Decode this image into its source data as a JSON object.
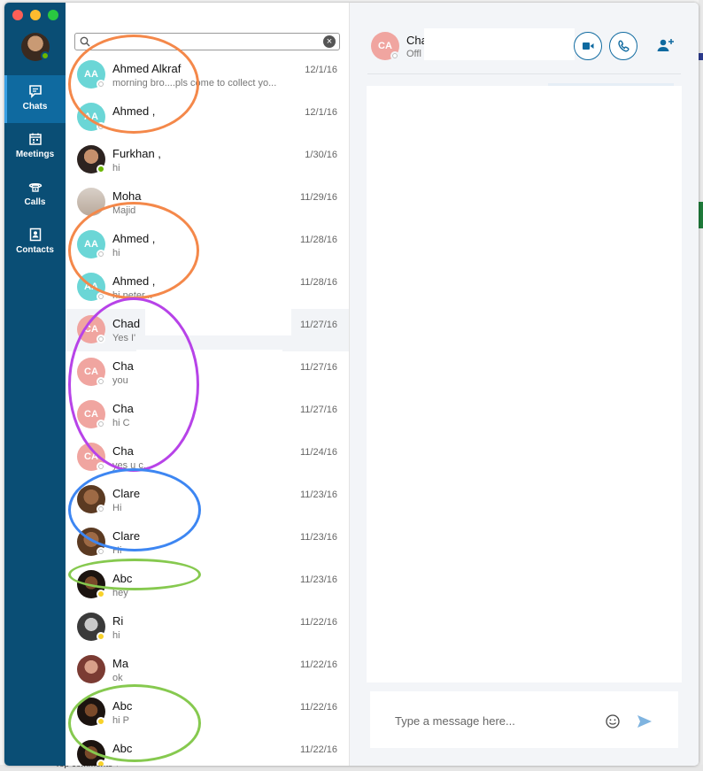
{
  "background": {
    "bottom_text": "Top comments ▾"
  },
  "rail": {
    "nav": [
      {
        "label": "Chats",
        "icon": "chat-icon"
      },
      {
        "label": "Meetings",
        "icon": "calendar-icon"
      },
      {
        "label": "Calls",
        "icon": "phone-icon"
      },
      {
        "label": "Contacts",
        "icon": "contacts-icon"
      }
    ]
  },
  "search": {
    "value": "",
    "placeholder": ""
  },
  "chats": [
    {
      "initials": "AA",
      "name": "Ahmed Alkraf",
      "preview": "morning bro....pls come to collect yo...",
      "date": "12/1/16",
      "presence": "offline"
    },
    {
      "initials": "AA",
      "name": "Ahmed ,",
      "preview": "",
      "date": "12/1/16",
      "presence": "offline"
    },
    {
      "initials": "",
      "name": "Furkhan ,",
      "preview": "hi",
      "date": "1/30/16",
      "presence": "online"
    },
    {
      "initials": "",
      "name": "Moha",
      "preview": "Majid",
      "date": "11/29/16",
      "presence": "none"
    },
    {
      "initials": "AA",
      "name": "Ahmed ,",
      "preview": "hi",
      "date": "11/28/16",
      "presence": "offline"
    },
    {
      "initials": "AA",
      "name": "Ahmed ,",
      "preview": "hi peter...",
      "date": "11/28/16",
      "presence": "offline"
    },
    {
      "initials": "CA",
      "name": "Chad",
      "preview": "Yes I'",
      "date": "11/27/16",
      "presence": "offline"
    },
    {
      "initials": "CA",
      "name": "Cha",
      "preview": "you",
      "date": "11/27/16",
      "presence": "offline"
    },
    {
      "initials": "CA",
      "name": "Cha",
      "preview": "hi C",
      "date": "11/27/16",
      "presence": "offline"
    },
    {
      "initials": "CA",
      "name": "Cha",
      "preview": "yes u c...",
      "date": "11/24/16",
      "presence": "offline"
    },
    {
      "initials": "",
      "name": "Clare",
      "preview": "Hi",
      "date": "11/23/16",
      "presence": "offline"
    },
    {
      "initials": "",
      "name": "Clare",
      "preview": "Hi",
      "date": "11/23/16",
      "presence": "offline"
    },
    {
      "initials": "",
      "name": "Abc",
      "preview": "hey",
      "date": "11/23/16",
      "presence": "away"
    },
    {
      "initials": "",
      "name": "Ri",
      "preview": "hi",
      "date": "11/22/16",
      "presence": "away"
    },
    {
      "initials": "",
      "name": "Ma",
      "preview": "ok",
      "date": "11/22/16",
      "presence": "none"
    },
    {
      "initials": "",
      "name": "Abc",
      "preview": "hi P",
      "date": "11/22/16",
      "presence": "away"
    },
    {
      "initials": "",
      "name": "Abc",
      "preview": "",
      "date": "11/22/16",
      "presence": "away"
    }
  ],
  "conversation": {
    "initials": "CA",
    "name": "Cha",
    "status": "Offl",
    "composer_placeholder": "Type a message here..."
  },
  "colors": {
    "rail": "#0a4e75",
    "rail_active": "#0f6aa0",
    "accent": "#0f6aa0",
    "ring_orange": "#f4884a",
    "ring_purple": "#b743e8",
    "ring_blue": "#3d86f2",
    "ring_green": "#86c94f"
  }
}
